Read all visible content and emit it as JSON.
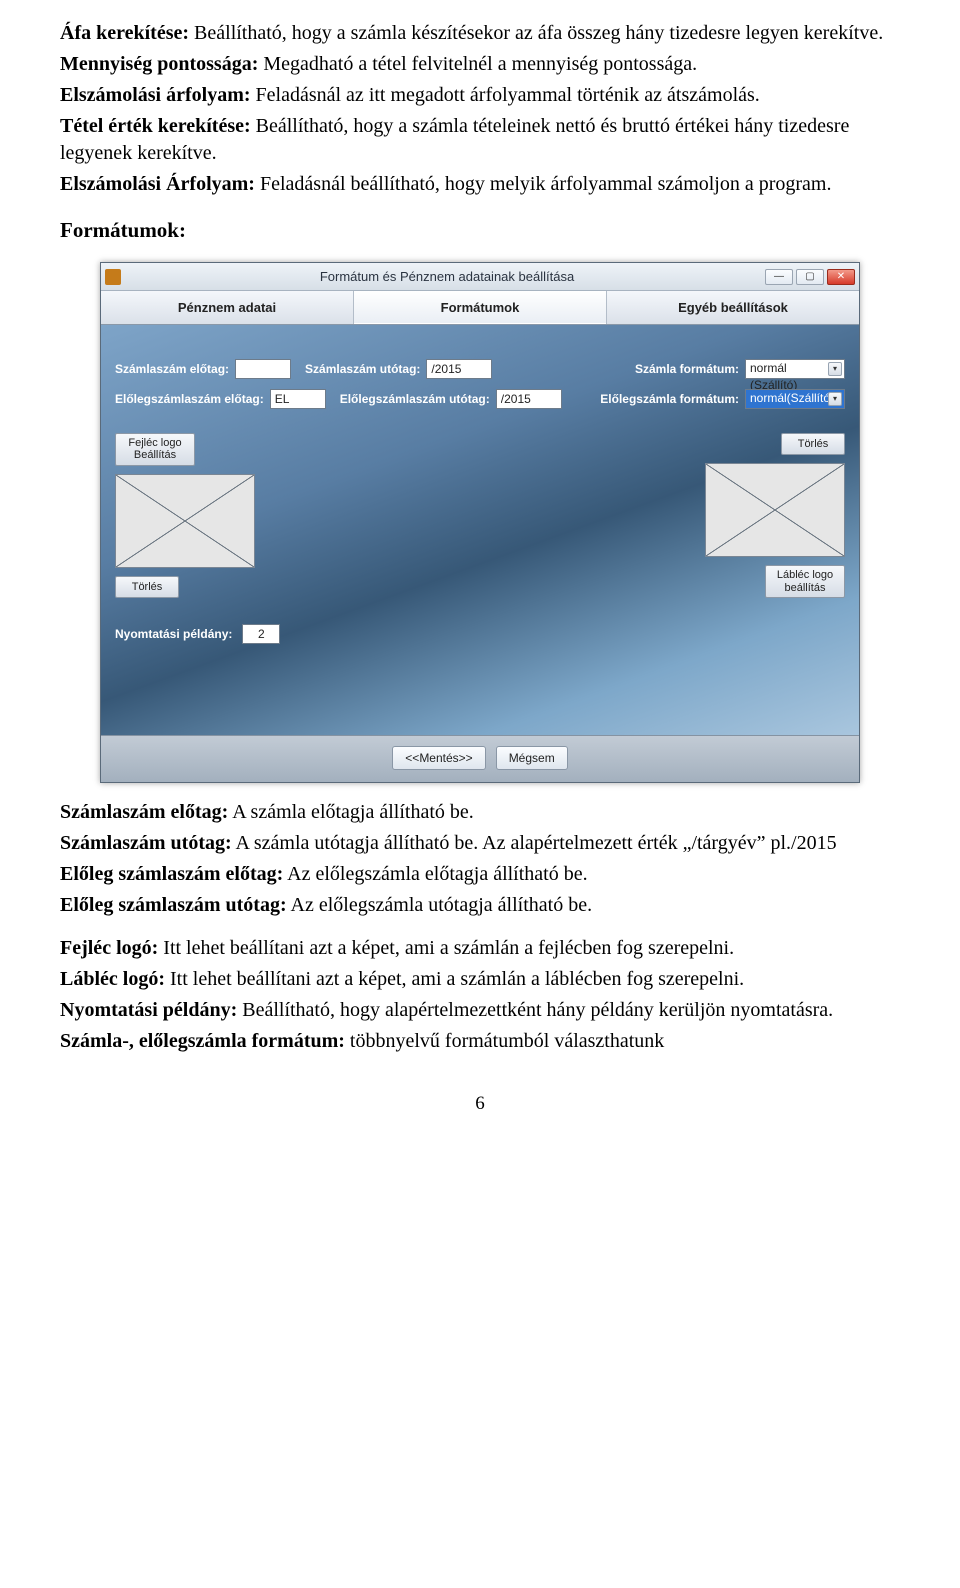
{
  "doc": {
    "p1_b": "Áfa kerekítése:",
    "p1_t": " Beállítható, hogy a számla készítésekor az áfa összeg hány tizedesre legyen kerekítve.",
    "p2_b": "Mennyiség pontossága:",
    "p2_t": " Megadható a tétel felvitelnél a mennyiség pontossága.",
    "p3_b": "Elszámolási árfolyam:",
    "p3_t": " Feladásnál az itt megadott árfolyammal történik az átszámolás.",
    "p4_b": "Tétel érték kerekítése:",
    "p4_t": " Beállítható, hogy a számla tételeinek nettó és bruttó értékei hány tizedesre legyenek kerekítve.",
    "p5_b": "Elszámolási Árfolyam:",
    "p5_t": " Feladásnál beállítható, hogy melyik árfolyammal számoljon a program.",
    "heading": "Formátumok:",
    "q1_b": "Számlaszám előtag:",
    "q1_t": " A számla előtagja állítható be.",
    "q2_b": "Számlaszám utótag:",
    "q2_t": " A számla utótagja állítható be. Az alapértelmezett érték „/tárgyév” pl./2015",
    "q3_b": "Előleg számlaszám előtag:",
    "q3_t": "  Az előlegszámla  előtagja állítható be.",
    "q4_b": "Előleg számlaszám utótag:",
    "q4_t": " Az előlegszámla utótagja állítható be.",
    "q5_b": "Fejléc logó:",
    "q5_t": " Itt lehet beállítani azt a képet, ami a számlán a fejlécben fog szerepelni.",
    "q6_b": "Lábléc logó:",
    "q6_t": " Itt lehet beállítani azt a képet, ami a számlán a láblécben fog szerepelni.",
    "q7_b": "Nyomtatási példány:",
    "q7_t": " Beállítható, hogy alapértelmezettként hány példány kerüljön nyomtatásra.",
    "q8_b": "Számla-, előlegszámla formátum:",
    "q8_t": " többnyelvű formátumból választhatunk",
    "page_number": "6"
  },
  "window": {
    "title": "Formátum és Pénznem adatainak beállítása",
    "tabs": {
      "t1": "Pénznem adatai",
      "t2": "Formátumok",
      "t3": "Egyéb beállítások"
    },
    "labels": {
      "szamlaszam_elotag": "Számlaszám előtag:",
      "szamlaszam_utotag": "Számlaszám utótag:",
      "szamla_formatum": "Számla formátum:",
      "eloleg_elotag": "Előlegszámlaszám előtag:",
      "eloleg_utotag": "Előlegszámlaszám utótag:",
      "eloleg_formatum": "Előlegszámla formátum:",
      "nyomtatasi_peldany": "Nyomtatási példány:"
    },
    "values": {
      "szamlaszam_elotag": "",
      "szamlaszam_utotag": "/2015",
      "szamla_formatum": "normál (Szállító)",
      "eloleg_elotag": "EL",
      "eloleg_utotag": "/2015",
      "eloleg_formatum": "normál(Szállító)",
      "nyomtatasi_peldany": "2"
    },
    "buttons": {
      "fejlec_logo": "Fejléc logo Beállítás",
      "torles_left": "Törlés",
      "torles_right": "Törlés",
      "lablec_logo": "Lábléc logo beállítás",
      "mentes": "<<Mentés>>",
      "megsem": "Mégsem"
    },
    "winbtns": {
      "min": "—",
      "max": "▢",
      "close": "✕"
    }
  }
}
